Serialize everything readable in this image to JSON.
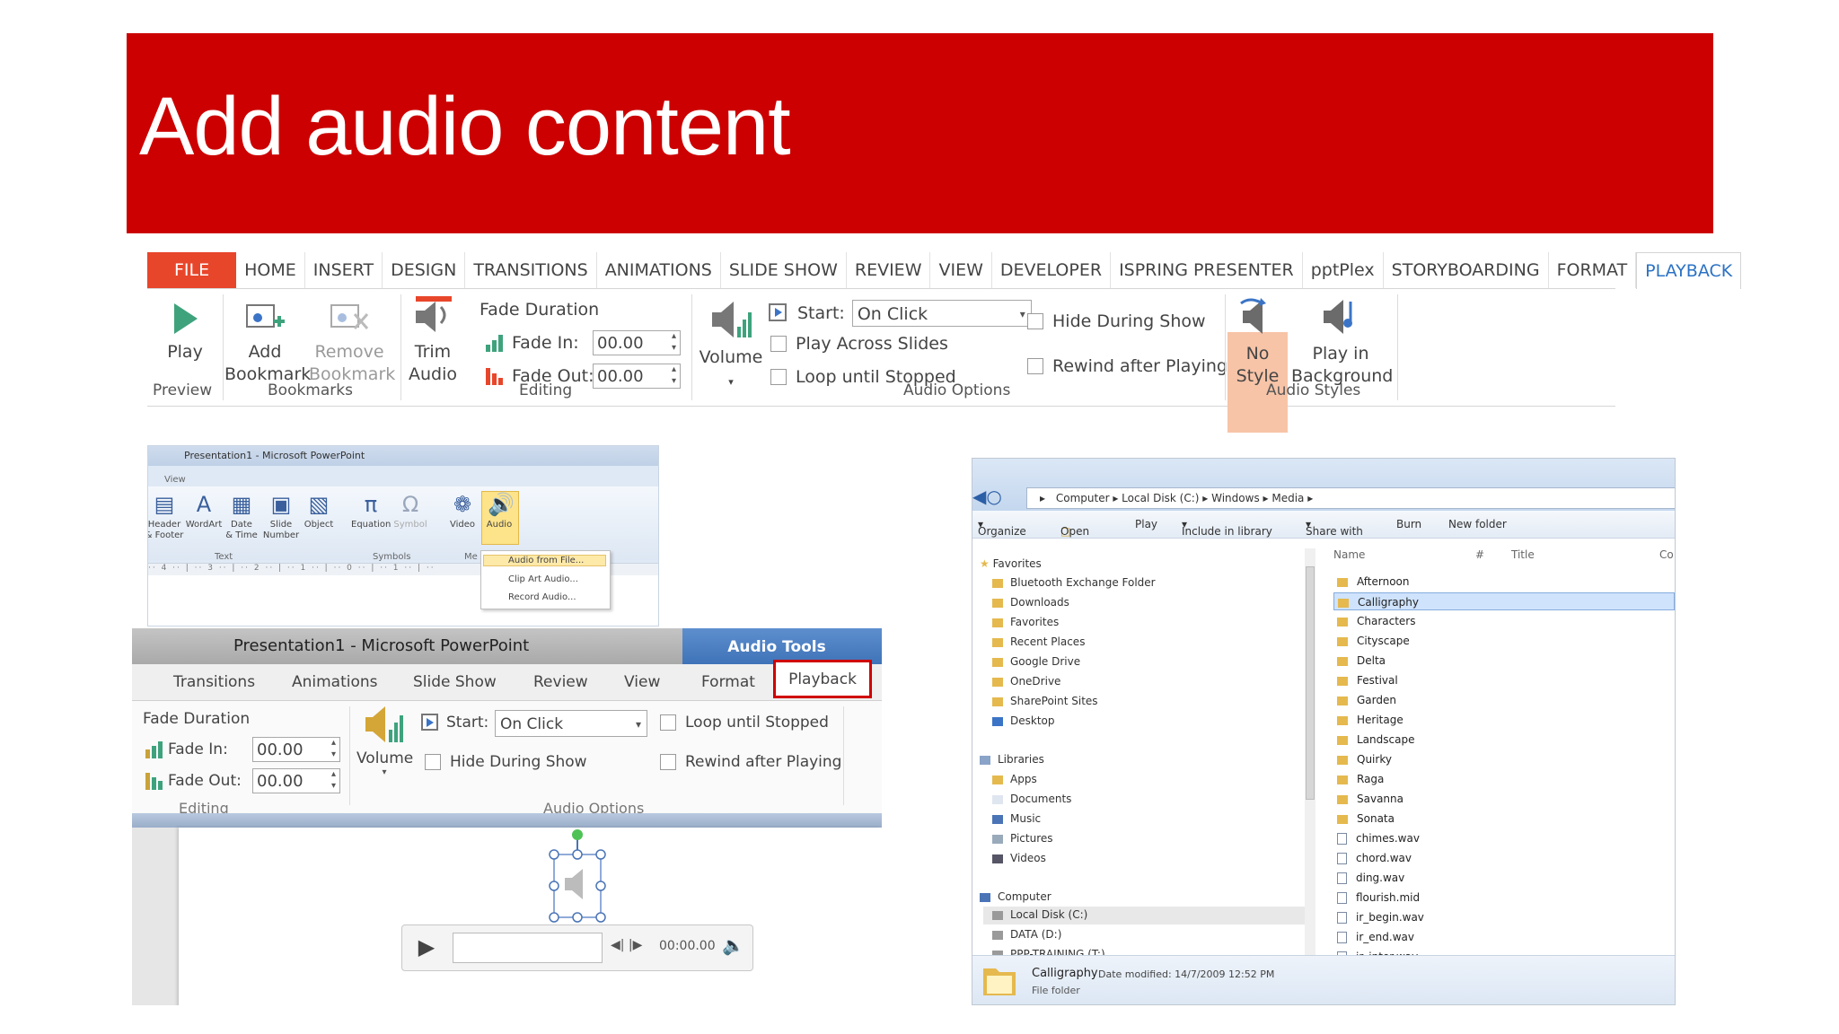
{
  "slide": {
    "title": "Add audio content"
  },
  "ribbon": {
    "tabs": [
      "FILE",
      "HOME",
      "INSERT",
      "DESIGN",
      "TRANSITIONS",
      "ANIMATIONS",
      "SLIDE SHOW",
      "REVIEW",
      "VIEW",
      "DEVELOPER",
      "ISPRING PRESENTER",
      "pptPlex",
      "STORYBOARDING",
      "FORMAT",
      "PLAYBACK"
    ],
    "play": "Play",
    "add_bookmark": [
      "Add",
      "Bookmark"
    ],
    "remove_bookmark": [
      "Remove",
      "Bookmark"
    ],
    "trim_audio": [
      "Trim",
      "Audio"
    ],
    "fade_duration": "Fade Duration",
    "fade_in_label": "Fade In:",
    "fade_in_value": "00.00",
    "fade_out_label": "Fade Out:",
    "fade_out_value": "00.00",
    "volume": "Volume",
    "start_label": "Start:",
    "start_value": "On Click",
    "play_across_slides": "Play Across Slides",
    "loop_until_stopped": "Loop until Stopped",
    "hide_during_show": "Hide During Show",
    "rewind_after_playing": "Rewind after Playing",
    "no_style": [
      "No",
      "Style"
    ],
    "play_in_background": [
      "Play in",
      "Background"
    ],
    "groups": {
      "preview": "Preview",
      "bookmarks": "Bookmarks",
      "editing": "Editing",
      "audio_options": "Audio Options",
      "audio_styles": "Audio Styles"
    },
    "accent": "#e8462b",
    "active_tab_color": "#2b72c4"
  },
  "insert_shot": {
    "title": "Presentation1 - Microsoft PowerPoint",
    "view": "View",
    "items": [
      [
        "Header",
        "& Footer"
      ],
      [
        "WordArt",
        ""
      ],
      [
        "Date",
        "& Time"
      ],
      [
        "Slide",
        "Number"
      ],
      [
        "Object",
        ""
      ],
      [
        "Equation",
        ""
      ],
      [
        "Symbol",
        ""
      ],
      [
        "Video",
        ""
      ],
      [
        "Audio",
        ""
      ]
    ],
    "groups": {
      "text": "Text",
      "symbols": "Symbols",
      "media": "Me"
    },
    "menu": [
      "Audio from File...",
      "Clip Art Audio...",
      "Record Audio..."
    ]
  },
  "audio_tools_shot": {
    "title": "Presentation1 - Microsoft PowerPoint",
    "contextual": "Audio Tools",
    "tabs": [
      "Transitions",
      "Animations",
      "Slide Show",
      "Review",
      "View",
      "Format",
      "Playback"
    ],
    "fade_duration": "Fade Duration",
    "fade_in_label": "Fade In:",
    "fade_in_value": "00.00",
    "fade_out_label": "Fade Out:",
    "fade_out_value": "00.00",
    "volume": "Volume",
    "start_label": "Start:",
    "start_value": "On Click",
    "hide_during_show": "Hide During Show",
    "loop_until_stopped": "Loop until Stopped",
    "rewind_after_playing": "Rewind after Playing",
    "groups": {
      "editing": "Editing",
      "audio_options": "Audio Options"
    },
    "time": "00:00.00",
    "highlight_color": "#d00000"
  },
  "explorer_shot": {
    "path": [
      "Computer",
      "Local Disk (C:)",
      "Windows",
      "Media"
    ],
    "commands": [
      "Organize",
      "Open",
      "Play",
      "Include in library",
      "Share with",
      "Burn",
      "New folder"
    ],
    "nav": {
      "favorites_header": "Favorites",
      "favorites": [
        "Bluetooth Exchange Folder",
        "Downloads",
        "Favorites",
        "Recent Places",
        "Google Drive",
        "OneDrive",
        "SharePoint Sites",
        "Desktop"
      ],
      "libraries_header": "Libraries",
      "libraries": [
        "Apps",
        "Documents",
        "Music",
        "Pictures",
        "Videos"
      ],
      "computer_header": "Computer",
      "computer": [
        "Local Disk (C:)",
        "DATA (D:)",
        "PPP-TRAINING (T:)"
      ]
    },
    "columns": [
      "Name",
      "#",
      "Title",
      "Co"
    ],
    "folders": [
      "Afternoon",
      "Calligraphy",
      "Characters",
      "Cityscape",
      "Delta",
      "Festival",
      "Garden",
      "Heritage",
      "Landscape",
      "Quirky",
      "Raga",
      "Savanna",
      "Sonata"
    ],
    "files": [
      "chimes.wav",
      "chord.wav",
      "ding.wav",
      "flourish.mid",
      "ir_begin.wav",
      "ir_end.wav",
      "ir_inter.wav"
    ],
    "selected": "Calligraphy",
    "details": {
      "name": "Calligraphy",
      "modified": "Date modified: 14/7/2009 12:52 PM",
      "kind": "File folder"
    }
  }
}
